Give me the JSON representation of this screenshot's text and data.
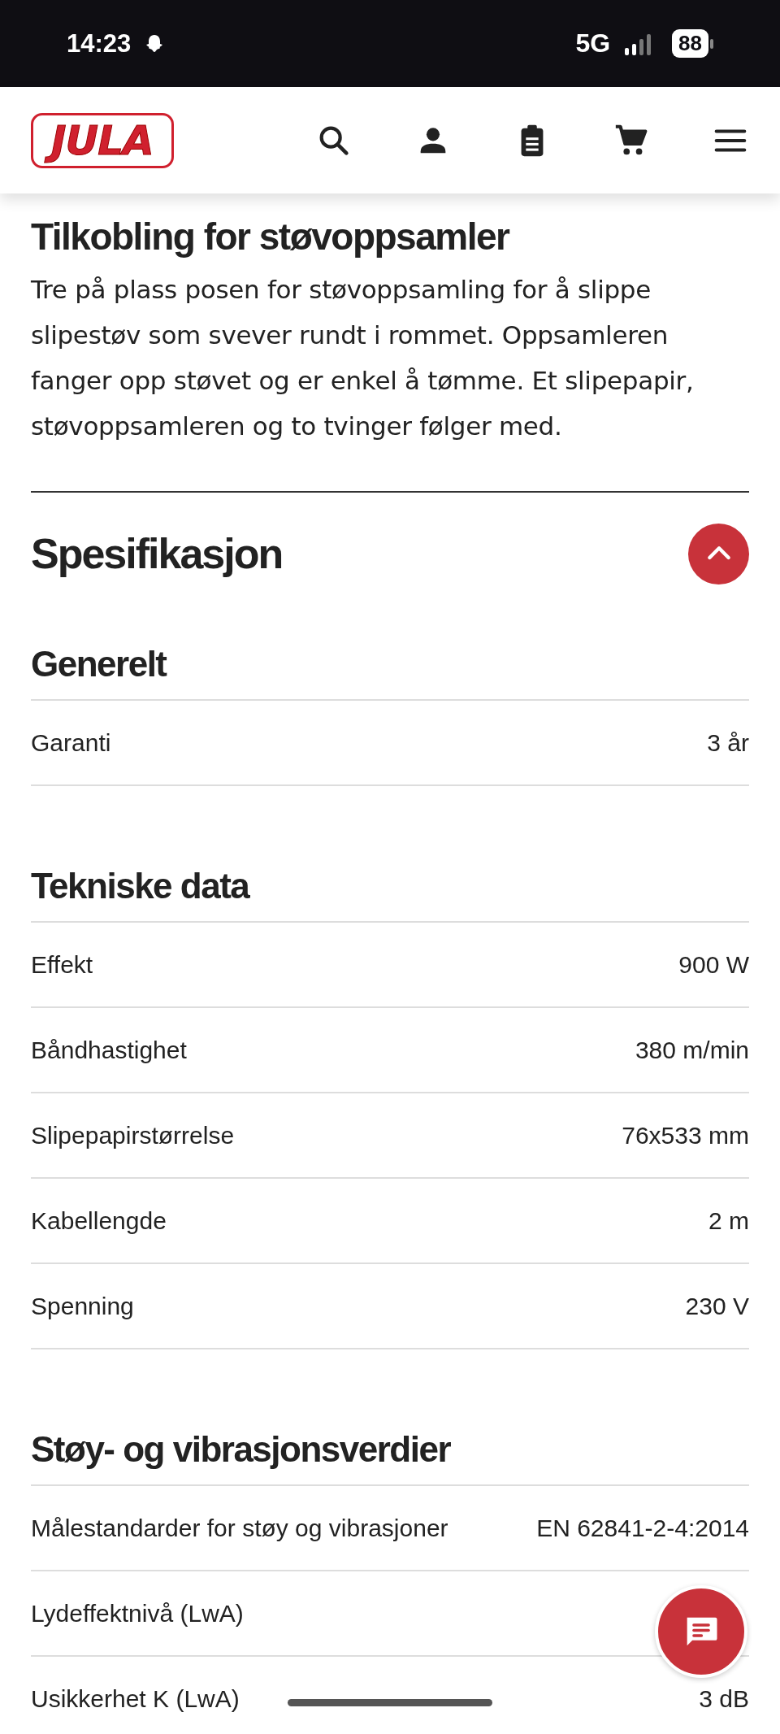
{
  "status_bar": {
    "time": "14:23",
    "network": "5G",
    "battery": "88"
  },
  "header": {
    "logo": "JULA"
  },
  "description": {
    "title": "Tilkobling for støvoppsamler",
    "text": "Tre på plass posen for støvoppsamling for å slippe slipestøv som svever rundt i rommet. Oppsamleren fanger opp støvet og er enkel å tømme. Et slipepapir, støvoppsamleren og to tvinger følger med."
  },
  "specification": {
    "title": "Spesifikasjon",
    "expanded": true,
    "groups": [
      {
        "title": "Generelt",
        "rows": [
          {
            "label": "Garanti",
            "value": "3 år"
          }
        ]
      },
      {
        "title": "Tekniske data",
        "rows": [
          {
            "label": "Effekt",
            "value": "900 W"
          },
          {
            "label": "Båndhastighet",
            "value": "380 m/min"
          },
          {
            "label": "Slipepapirstørrelse",
            "value": "76x533 mm"
          },
          {
            "label": "Kabellengde",
            "value": "2 m"
          },
          {
            "label": "Spenning",
            "value": "230 V"
          }
        ]
      },
      {
        "title": "Støy- og vibrasjonsverdier",
        "rows": [
          {
            "label": "Målestandarder for støy og vibrasjoner",
            "value": "EN 62841-2-4:2014"
          },
          {
            "label": "Lydeffektnivå (LwA)"
          },
          {
            "label": "Usikkerhet K (LwA)",
            "value": "3 dB"
          }
        ]
      }
    ]
  }
}
